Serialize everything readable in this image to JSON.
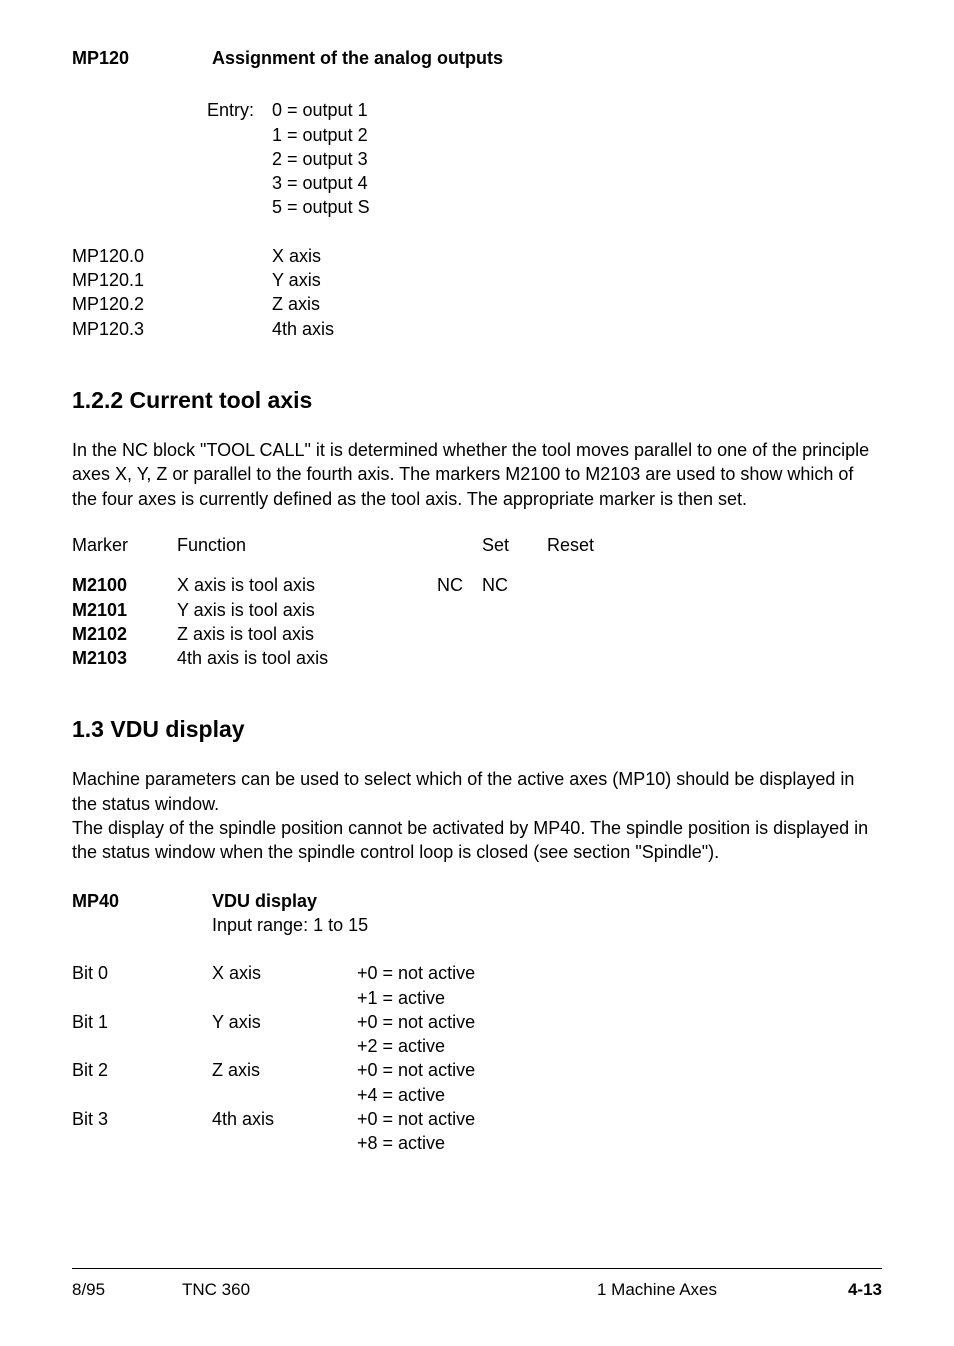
{
  "mp120": {
    "code": "MP120",
    "title": "Assignment of the analog outputs",
    "entry_label": "Entry:",
    "entries": [
      "0 = output 1",
      "1 = output 2",
      "2 = output 3",
      "3 = output 4",
      "5 = output S"
    ],
    "axes": [
      {
        "code": "MP120.0",
        "label": "X axis"
      },
      {
        "code": "MP120.1",
        "label": "Y axis"
      },
      {
        "code": "MP120.2",
        "label": "Z axis"
      },
      {
        "code": "MP120.3",
        "label": "4th axis"
      }
    ]
  },
  "sec122": {
    "heading": "1.2.2  Current tool axis",
    "para": "In the NC block \"TOOL CALL\" it is determined whether the tool moves parallel to one of the principle axes X, Y, Z or parallel to the fourth axis. The markers M2100 to M2103 are used to show which of the four axes is currently defined as the tool axis. The appropriate marker is then set.",
    "head": {
      "marker": "Marker",
      "func": "Function",
      "set": "Set",
      "reset": "Reset"
    },
    "rows": [
      {
        "marker": "M2100",
        "func": "X axis is tool axis",
        "set": "NC",
        "reset": "NC"
      },
      {
        "marker": "M2101",
        "func": "Y axis is tool axis",
        "set": "",
        "reset": ""
      },
      {
        "marker": "M2102",
        "func": "Z axis is tool axis",
        "set": "",
        "reset": ""
      },
      {
        "marker": "M2103",
        "func": "4th axis is tool axis",
        "set": "",
        "reset": ""
      }
    ]
  },
  "sec13": {
    "heading": "1.3  VDU display",
    "para1": "Machine parameters can be used to select which of the active axes (MP10) should be displayed in the status window.",
    "para2": "The display of the spindle position cannot be activated by MP40. The spindle position is displayed in the status window when the spindle control loop is closed (see section \"Spindle\").",
    "mp40": {
      "code": "MP40",
      "title": "VDU display",
      "range": "Input range: 1 to 15",
      "bits": [
        {
          "bit": "Bit 0",
          "axis": "X axis",
          "l1": "+0 = not active",
          "l2": "+1 = active"
        },
        {
          "bit": "Bit 1",
          "axis": "Y axis",
          "l1": "+0 = not active",
          "l2": "+2 = active"
        },
        {
          "bit": "Bit 2",
          "axis": "Z axis",
          "l1": "+0 = not active",
          "l2": "+4 = active"
        },
        {
          "bit": "Bit 3",
          "axis": "4th axis",
          "l1": "+0 = not active",
          "l2": "+8 = active"
        }
      ]
    }
  },
  "footer": {
    "date": "8/95",
    "model": "TNC 360",
    "chapter": "1  Machine Axes",
    "page": "4-13"
  }
}
